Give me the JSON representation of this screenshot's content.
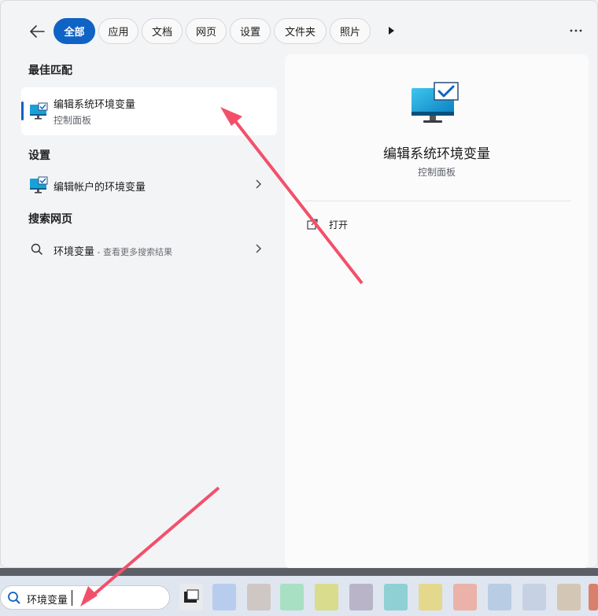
{
  "header": {
    "back_icon": "back-arrow-icon",
    "filters": [
      "全部",
      "应用",
      "文档",
      "网页",
      "设置",
      "文件夹",
      "照片"
    ],
    "active_filter": "全部",
    "more_filters_icon": "play-triangle-icon",
    "more_icon": "ellipsis-icon"
  },
  "best_match": {
    "section": "最佳匹配",
    "title": "编辑系统环境变量",
    "subtitle": "控制面板",
    "icon": "monitor-check-icon"
  },
  "settings": {
    "section": "设置",
    "item_label": "编辑帐户的环境变量",
    "icon": "monitor-check-icon"
  },
  "web": {
    "section": "搜索网页",
    "query": "环境变量",
    "extra": " - 查看更多搜索结果",
    "icon": "search-icon"
  },
  "detail": {
    "title": "编辑系统环境变量",
    "subtitle": "控制面板",
    "open_label": "打开",
    "open_icon": "open-external-icon"
  },
  "taskbar": {
    "search_value": "环境变量",
    "search_icon": "search-icon"
  },
  "colors": {
    "accent": "#0f63c4",
    "arrow": "#f2506a"
  }
}
